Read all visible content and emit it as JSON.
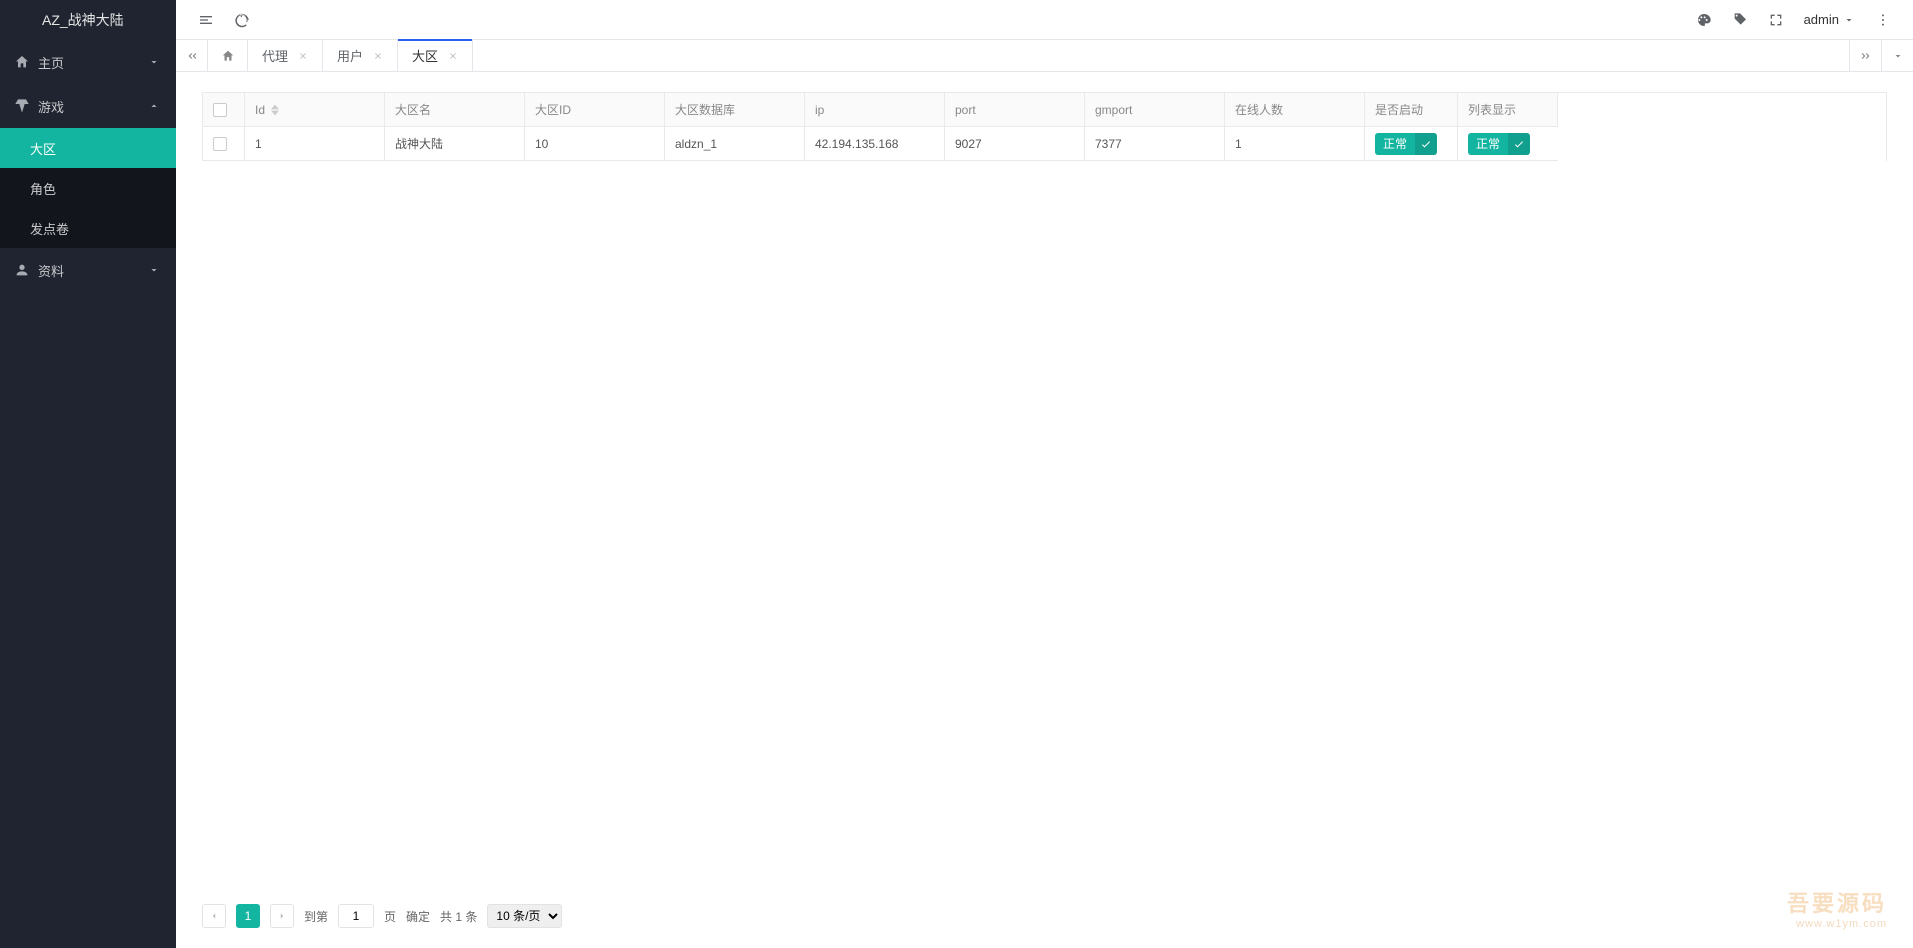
{
  "brand": "AZ_战神大陆",
  "sidebar": {
    "items": [
      {
        "icon": "home",
        "label": "主页",
        "arrow": "down"
      },
      {
        "icon": "diamond",
        "label": "游戏",
        "arrow": "up",
        "children": [
          {
            "label": "大区",
            "active": true
          },
          {
            "label": "角色"
          },
          {
            "label": "发点卷"
          }
        ]
      },
      {
        "icon": "user",
        "label": "资料",
        "arrow": "down"
      }
    ]
  },
  "header": {
    "user": "admin"
  },
  "tabs": [
    {
      "icon": "home"
    },
    {
      "label": "代理"
    },
    {
      "label": "用户"
    },
    {
      "label": "大区",
      "active": true
    }
  ],
  "table": {
    "columns": [
      {
        "key": "checkbox"
      },
      {
        "key": "id",
        "label": "Id",
        "sortable": true
      },
      {
        "key": "name",
        "label": "大区名"
      },
      {
        "key": "zone_id",
        "label": "大区ID"
      },
      {
        "key": "db",
        "label": "大区数据库"
      },
      {
        "key": "ip",
        "label": "ip"
      },
      {
        "key": "port",
        "label": "port"
      },
      {
        "key": "gmport",
        "label": "gmport"
      },
      {
        "key": "online",
        "label": "在线人数"
      },
      {
        "key": "enabled",
        "label": "是否启动"
      },
      {
        "key": "listshow",
        "label": "列表显示"
      }
    ],
    "rows": [
      {
        "id": "1",
        "name": "战神大陆",
        "zone_id": "10",
        "db": "aldzn_1",
        "ip": "42.194.135.168",
        "port": "9027",
        "gmport": "7377",
        "online": "1",
        "enabled": "正常",
        "listshow": "正常"
      }
    ]
  },
  "pager": {
    "current": "1",
    "goto_label": "到第",
    "goto_value": "1",
    "page_unit": "页",
    "confirm": "确定",
    "total": "共 1 条",
    "per_page": "10 条/页"
  },
  "watermark": {
    "line1": "吾要源码",
    "line2": "www.w1ym.com"
  }
}
